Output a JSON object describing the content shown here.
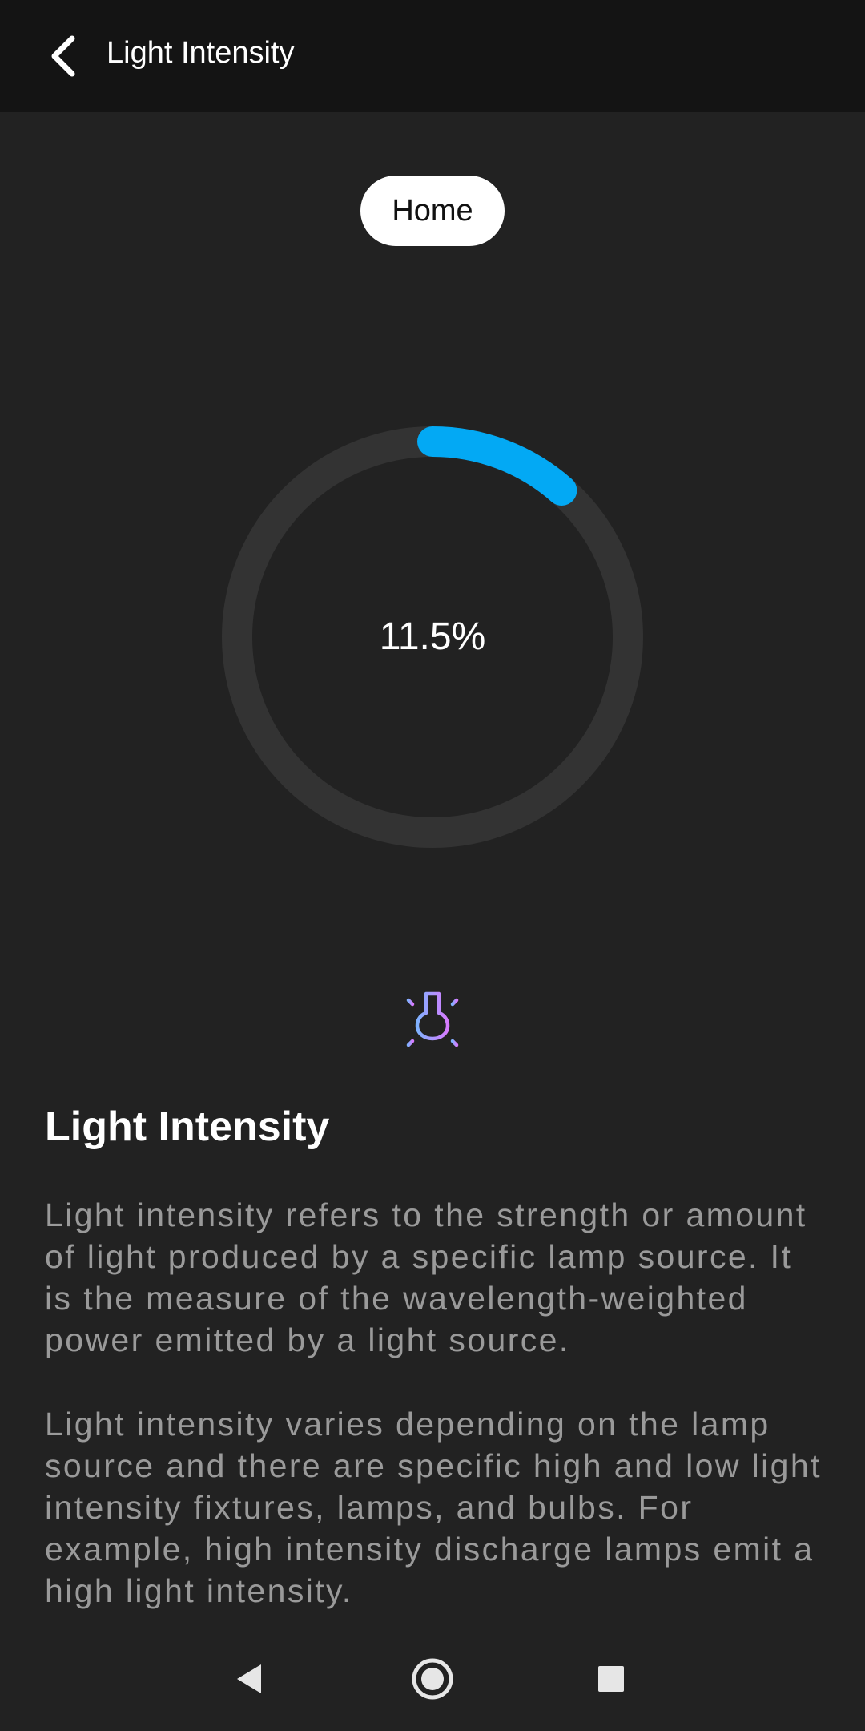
{
  "appbar": {
    "title": "Light Intensity",
    "back_icon": "arrow-back-icon"
  },
  "chip": {
    "label": "Home"
  },
  "gauge": {
    "value_text": "11.5%",
    "fraction": 0.115,
    "track_color": "#333333",
    "progress_color": "#03A9F4"
  },
  "info": {
    "icon": "lightbulb-icon",
    "title": "Light Intensity",
    "paragraphs": [
      "Light intensity refers to the strength or amount of light produced by a specific lamp source. It is the measure of the wavelength-weighted power emitted by a light source.",
      "Light intensity varies depending on the lamp source and there are specific high and low light intensity fixtures, lamps, and bulbs. For example, high intensity discharge lamps emit a high light intensity."
    ]
  },
  "colors": {
    "background": "#222222",
    "appbar": "#141414",
    "text_primary": "#FFFFFF",
    "text_secondary": "#9A9A9A"
  },
  "navigation": {
    "back": "nav-back-icon",
    "home": "nav-home-icon",
    "recents": "nav-recents-icon"
  }
}
